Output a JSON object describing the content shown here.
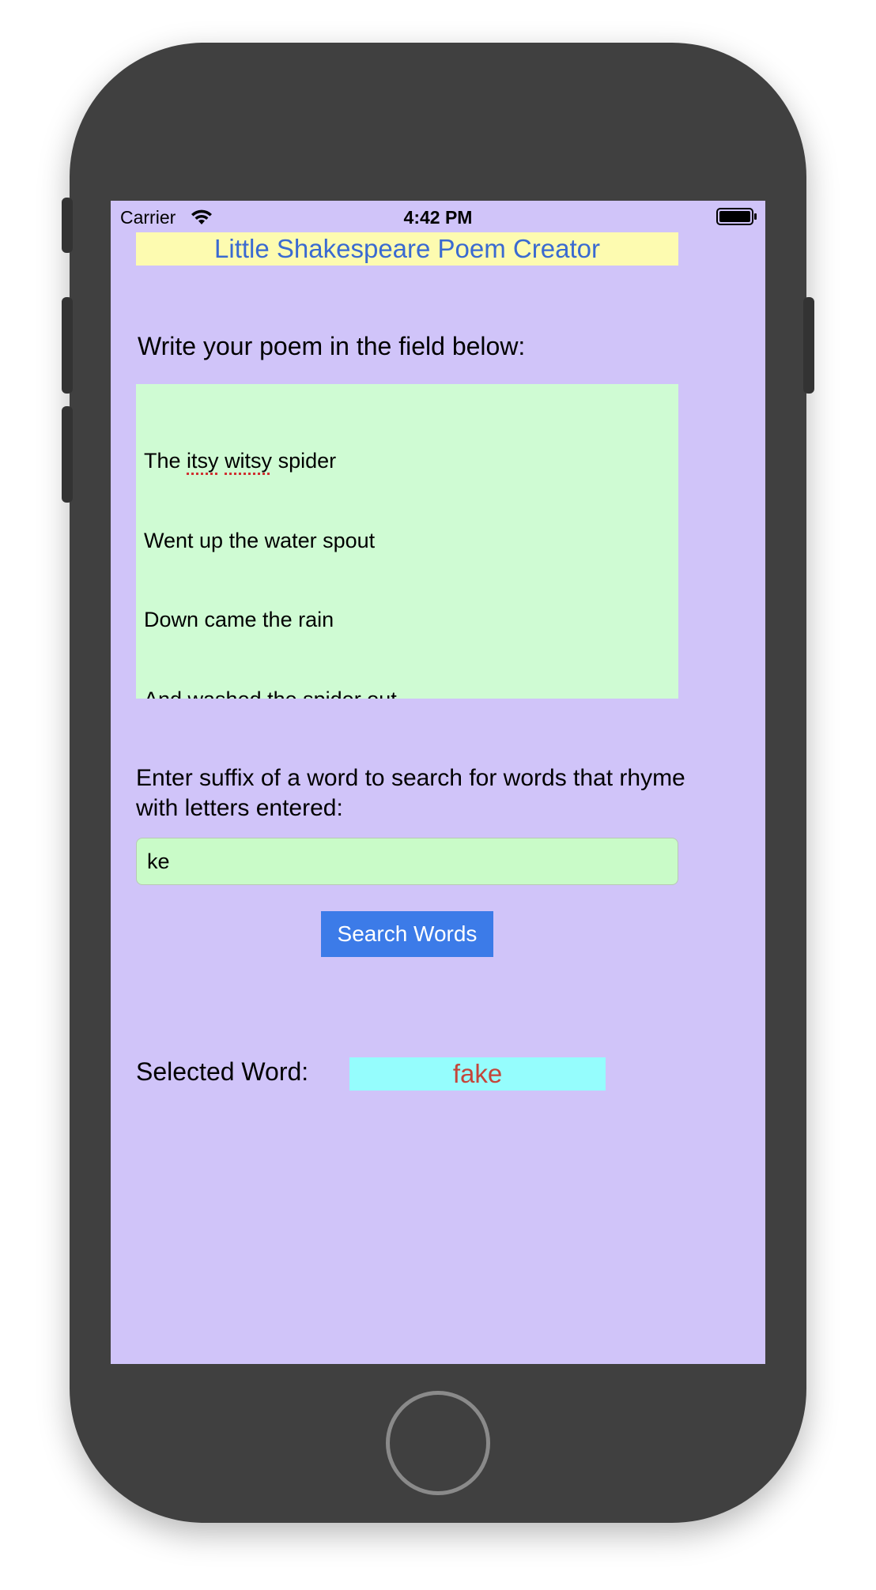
{
  "status_bar": {
    "carrier": "Carrier",
    "time": "4:42 PM",
    "icons": [
      "wifi-icon",
      "battery-icon"
    ]
  },
  "app": {
    "title": "Little Shakespeare Poem Creator",
    "poem_label": "Write your poem in the field below:",
    "poem_lines": [
      "The itsy witsy spider",
      "Went up the water spout",
      "Down came the rain",
      "And washed the spider out"
    ],
    "suffix_label": "Enter suffix of a word to search for words that rhyme with letters entered:",
    "suffix_value": "ke",
    "search_button_label": "Search Words",
    "selected_label": "Selected Word:",
    "selected_word": "fake"
  },
  "colors": {
    "screen_background": "#d0c4f9",
    "title_background": "#fdfbb0",
    "title_text": "#3a6ad1",
    "poem_background": "#cffbd3",
    "input_background": "#c9fbc8",
    "button_background": "#3c7be8",
    "selected_background": "#95fdfd",
    "selected_text": "#c4453a",
    "phone_body": "#404040"
  }
}
